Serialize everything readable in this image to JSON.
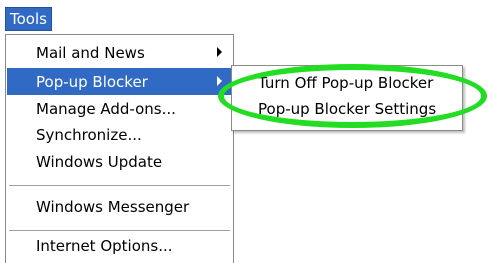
{
  "menubar": {
    "tools_label": "Tools"
  },
  "main_menu": {
    "items": [
      {
        "label": "Mail and News"
      },
      {
        "label": "Pop-up Blocker"
      },
      {
        "label": "Manage Add-ons..."
      },
      {
        "label": "Synchronize..."
      },
      {
        "label": "Windows Update"
      },
      {
        "label": "Windows Messenger"
      },
      {
        "label": "Internet Options..."
      }
    ]
  },
  "submenu": {
    "items": [
      {
        "label": "Turn Off Pop-up Blocker"
      },
      {
        "label": "Pop-up Blocker Settings"
      }
    ]
  },
  "annotation": {
    "color": "#22dd22"
  },
  "colors": {
    "highlight": "#316ac5"
  }
}
